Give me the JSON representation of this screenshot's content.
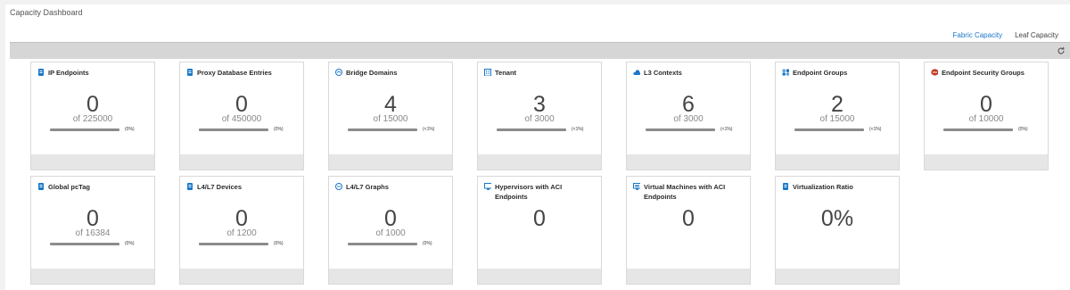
{
  "page": {
    "title": "Capacity Dashboard"
  },
  "tabs": [
    {
      "label": "Fabric Capacity",
      "active": true
    },
    {
      "label": "Leaf Capacity",
      "active": false
    }
  ],
  "toolbar": {
    "refresh_icon": "refresh-icon"
  },
  "cards": [
    {
      "title": "IP Endpoints",
      "icon": "endpoint-icon",
      "value": "0",
      "of": "of 225000",
      "percent": "(0%)"
    },
    {
      "title": "Proxy Database Entries",
      "icon": "database-icon",
      "value": "0",
      "of": "of 450000",
      "percent": "(0%)"
    },
    {
      "title": "Bridge Domains",
      "icon": "bridge-domain-icon",
      "value": "4",
      "of": "of 15000",
      "percent": "(<1%)"
    },
    {
      "title": "Tenant",
      "icon": "tenant-icon",
      "value": "3",
      "of": "of 3000",
      "percent": "(<1%)"
    },
    {
      "title": "L3 Contexts",
      "icon": "cloud-icon",
      "value": "6",
      "of": "of 3000",
      "percent": "(<1%)"
    },
    {
      "title": "Endpoint Groups",
      "icon": "endpoint-group-icon",
      "value": "2",
      "of": "of 15000",
      "percent": "(<1%)"
    },
    {
      "title": "Endpoint Security Groups",
      "icon": "security-group-icon",
      "value": "0",
      "of": "of 10000",
      "percent": "(0%)"
    },
    {
      "title": "Global pcTag",
      "icon": "tag-icon",
      "value": "0",
      "of": "of 16384",
      "percent": "(0%)"
    },
    {
      "title": "L4/L7 Devices",
      "icon": "device-icon",
      "value": "0",
      "of": "of 1200",
      "percent": "(0%)"
    },
    {
      "title": "L4/L7 Graphs",
      "icon": "graph-icon",
      "value": "0",
      "of": "of 1000",
      "percent": "(0%)"
    },
    {
      "title": "Hypervisors with ACI Endpoints",
      "icon": "monitor-icon",
      "value": "0"
    },
    {
      "title": "Virtual Machines with ACI Endpoints",
      "icon": "vm-icon",
      "value": "0"
    },
    {
      "title": "Virtualization Ratio",
      "icon": "ratio-icon",
      "value": "0%"
    }
  ]
}
